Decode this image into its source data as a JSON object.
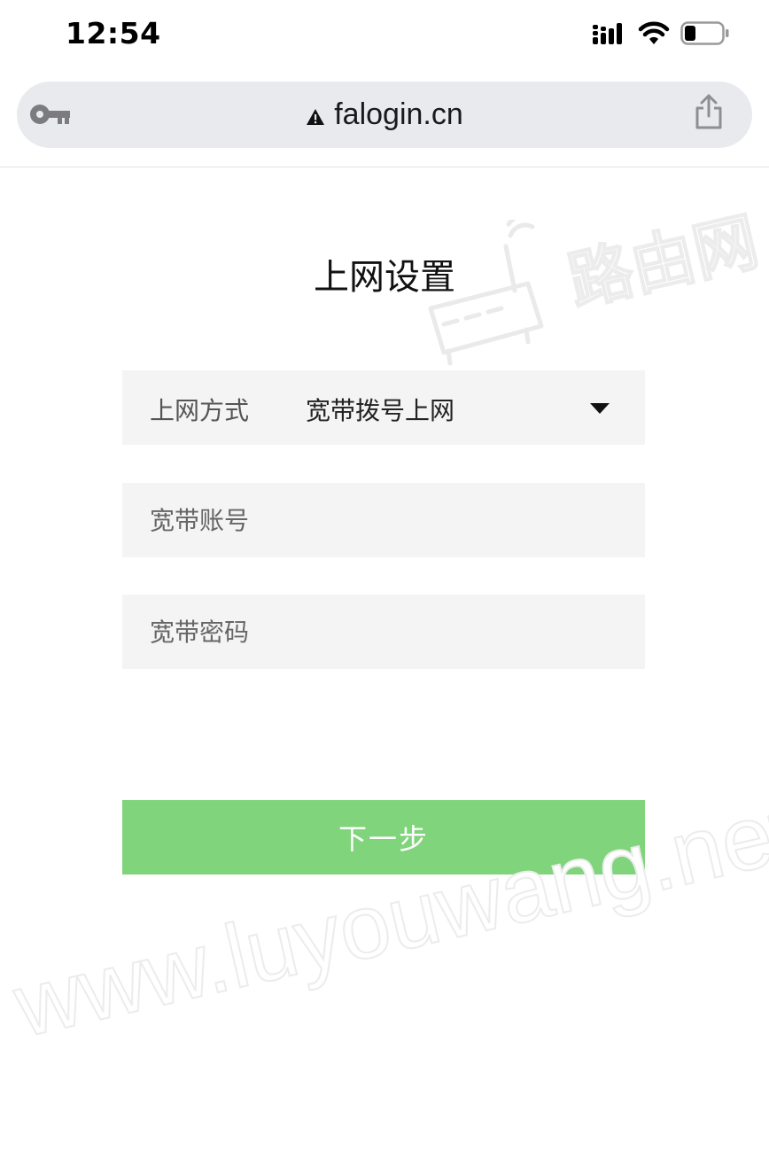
{
  "status_bar": {
    "time": "12:54"
  },
  "address_bar": {
    "url": "falogin.cn"
  },
  "page": {
    "title": "上网设置"
  },
  "form": {
    "method_label": "上网方式",
    "method_value": "宽带拨号上网",
    "account_placeholder": "宽带账号",
    "account_value": "",
    "password_placeholder": "宽带密码",
    "password_value": "",
    "next_label": "下一步"
  },
  "watermark": {
    "url_text": "www.luyouwang.net",
    "logo_text": "路由网"
  },
  "colors": {
    "primary_button": "#80d47b",
    "field_background": "#f4f4f4",
    "address_bar_background": "#e9eaee"
  },
  "icons": {
    "signal": "signal-icon",
    "wifi": "wifi-icon",
    "battery": "battery-icon",
    "key": "key-icon",
    "warning": "warning-icon",
    "share": "share-icon",
    "dropdown": "caret-down-icon"
  }
}
